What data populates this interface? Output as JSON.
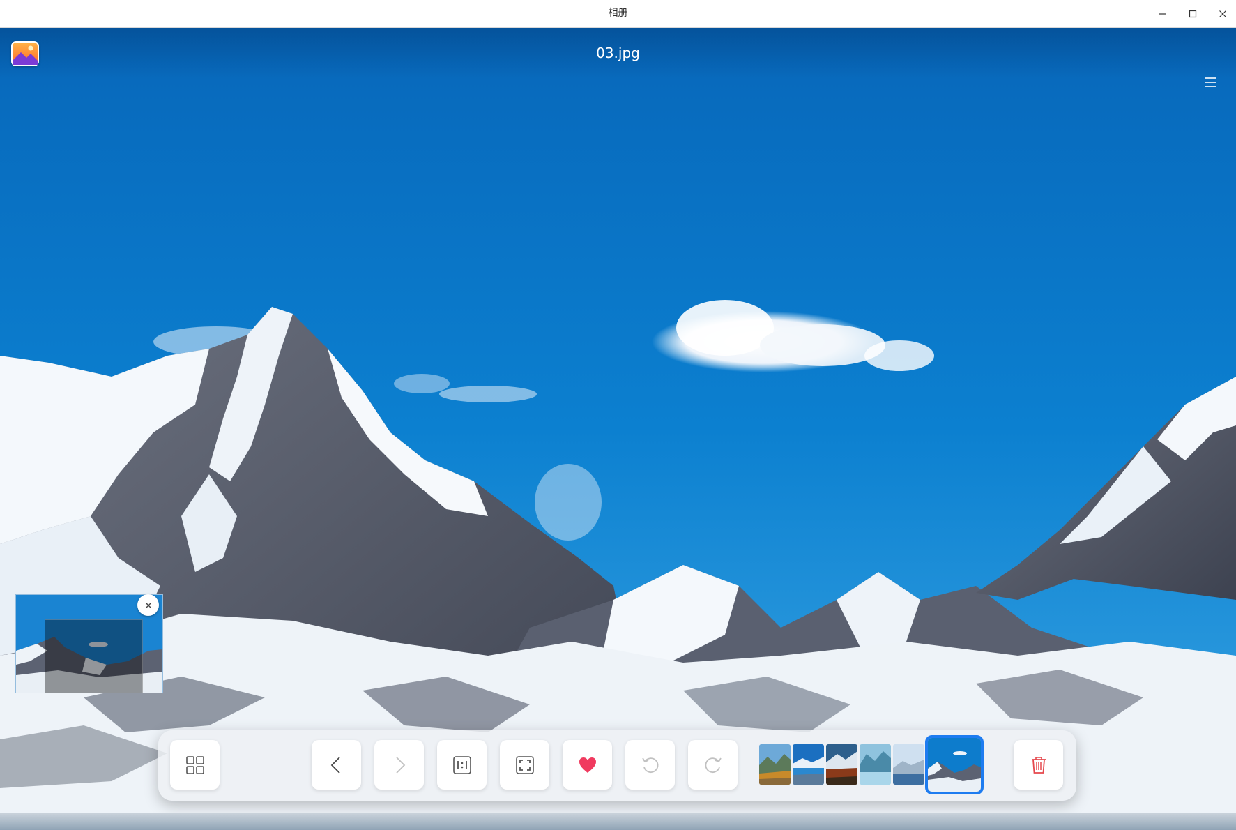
{
  "window": {
    "title": "相册",
    "controls": [
      "minimize-icon",
      "maximize-icon",
      "close-icon"
    ]
  },
  "viewer": {
    "file_name": "03.jpg",
    "app_icon": "album-app-icon",
    "menu_icon": "hamburger-menu-icon"
  },
  "navigator": {
    "close_icon": "close-icon"
  },
  "toolbar": {
    "buttons": [
      {
        "name": "gallery-grid-button",
        "icon": "grid-icon",
        "enabled": true
      },
      {
        "name": "previous-button",
        "icon": "chevron-left-icon",
        "enabled": true
      },
      {
        "name": "next-button",
        "icon": "chevron-right-icon",
        "enabled": false
      },
      {
        "name": "original-size-button",
        "icon": "one-to-one-icon",
        "enabled": true
      },
      {
        "name": "fit-window-button",
        "icon": "fit-screen-icon",
        "enabled": true
      },
      {
        "name": "favorite-button",
        "icon": "heart-icon",
        "enabled": true,
        "active": true
      },
      {
        "name": "rotate-left-button",
        "icon": "rotate-ccw-icon",
        "enabled": false
      },
      {
        "name": "rotate-right-button",
        "icon": "rotate-cw-icon",
        "enabled": false
      },
      {
        "name": "delete-button",
        "icon": "trash-icon",
        "enabled": true
      }
    ],
    "thumbnails_count": 6,
    "current_thumbnail_index": 5
  },
  "colors": {
    "accent": "#1e7cf0",
    "favorite": "#f03a5f",
    "delete": "#e5484d",
    "sky": "#0a7ccd"
  }
}
